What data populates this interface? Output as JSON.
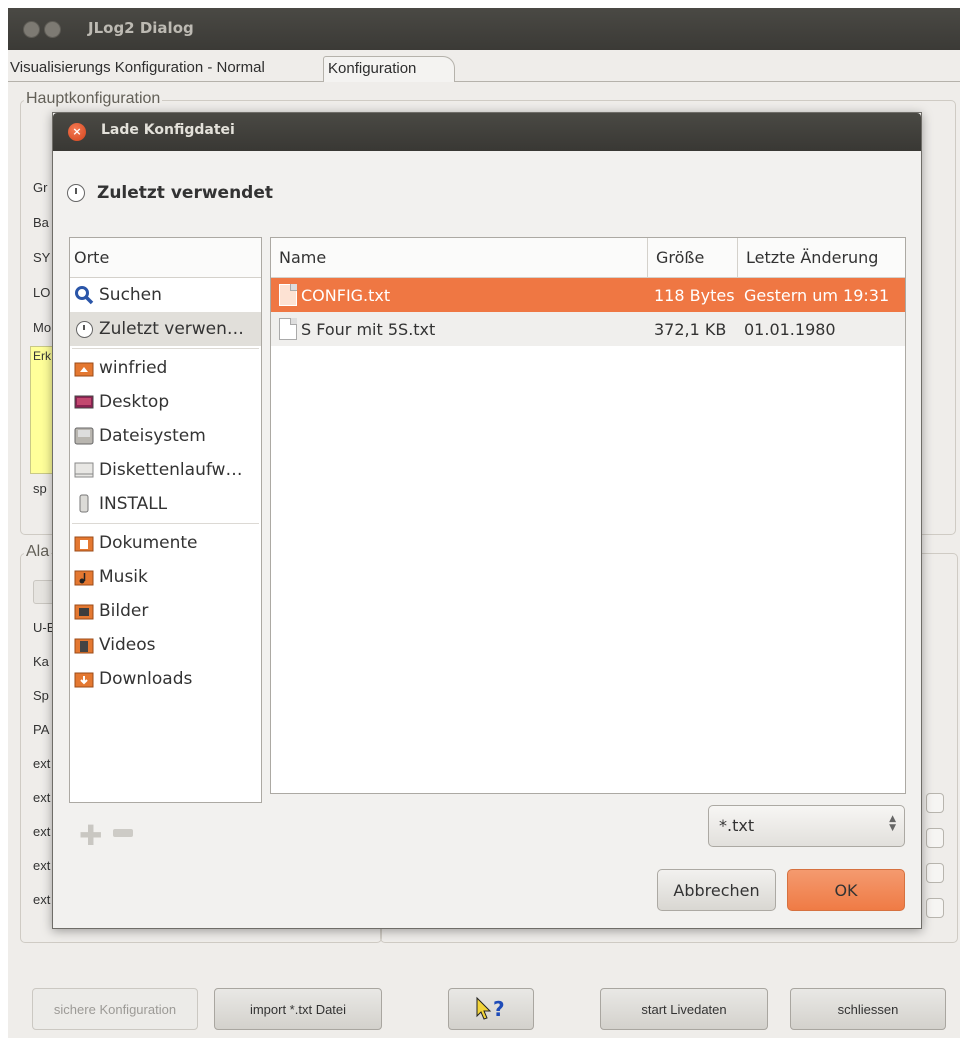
{
  "background_window": {
    "title": "JLog2 Dialog",
    "tabs": [
      "Visualisierungs Konfiguration - Normal",
      "Konfiguration"
    ],
    "group_main": "Hauptkonfiguration",
    "group_alarm": "Ala",
    "left_fragments": [
      "Gr",
      "Ba",
      "SY",
      "LO",
      "Mo",
      "Erk",
      "sp"
    ],
    "left_fragments_lower": [
      "U-E",
      "Ka",
      "Sp",
      "PA",
      "ext",
      "ext",
      "ext",
      "ext",
      "ext"
    ],
    "bottom_buttons": {
      "save": "sichere Konfiguration",
      "import": "import *.txt Datei",
      "help": "?",
      "start": "start Livedaten",
      "close": "schliessen"
    }
  },
  "dialog": {
    "title": "Lade Konfigdatei",
    "location": "Zuletzt verwendet",
    "places_header": "Orte",
    "places": [
      {
        "label": "Suchen",
        "icon": "search-icon"
      },
      {
        "label": "Zuletzt verwen…",
        "icon": "recent-icon",
        "selected": true
      },
      {
        "label": "winfried",
        "icon": "home-folder-icon"
      },
      {
        "label": "Desktop",
        "icon": "desktop-icon"
      },
      {
        "label": "Dateisystem",
        "icon": "filesystem-icon"
      },
      {
        "label": "Diskettenlaufw…",
        "icon": "floppy-icon"
      },
      {
        "label": "INSTALL",
        "icon": "usb-drive-icon"
      },
      {
        "label": "Dokumente",
        "icon": "documents-folder-icon"
      },
      {
        "label": "Musik",
        "icon": "music-folder-icon"
      },
      {
        "label": "Bilder",
        "icon": "pictures-folder-icon"
      },
      {
        "label": "Videos",
        "icon": "videos-folder-icon"
      },
      {
        "label": "Downloads",
        "icon": "downloads-folder-icon"
      }
    ],
    "columns": {
      "name": "Name",
      "size": "Größe",
      "modified": "Letzte Änderung"
    },
    "files": [
      {
        "name": "CONFIG.txt",
        "size": "118 Bytes",
        "modified": "Gestern um 19:31",
        "selected": true
      },
      {
        "name": "S Four mit 5S.txt",
        "size": "372,1 KB",
        "modified": "01.01.1980",
        "selected": false
      }
    ],
    "filter": "*.txt",
    "cancel_label": "Abbrechen",
    "ok_label": "OK"
  },
  "colors": {
    "selection": "#ef7743",
    "titlebar": "#3b3a36",
    "ok_button": "#f08250",
    "close_button": "#e05a2d",
    "highlight_yellow": "#ffff9a"
  }
}
